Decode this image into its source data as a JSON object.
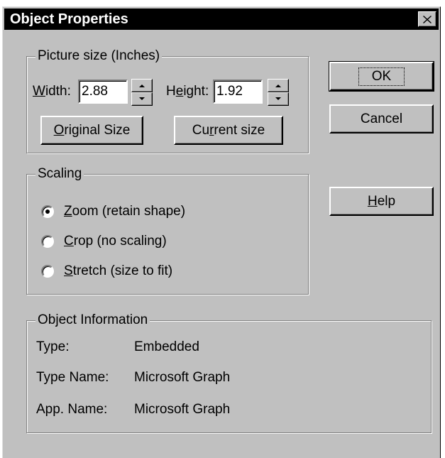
{
  "title": "Object Properties",
  "picture_size": {
    "group_label": "Picture size (Inches)",
    "width_label_u": "W",
    "width_label_rest": "idth:",
    "width_value": "2.88",
    "height_label_pre": "H",
    "height_label_u": "e",
    "height_label_rest": "ight:",
    "height_value": "1.92",
    "original_u": "O",
    "original_rest": "riginal Size",
    "current_pre": "Cu",
    "current_u": "r",
    "current_rest": "rent size"
  },
  "scaling": {
    "group_label": "Scaling",
    "options": [
      {
        "u": "Z",
        "rest": "oom (retain shape)",
        "selected": true
      },
      {
        "u": "C",
        "rest": "rop (no scaling)",
        "selected": false
      },
      {
        "u": "S",
        "rest": "tretch (size to fit)",
        "selected": false
      }
    ]
  },
  "object_info": {
    "group_label": "Object Information",
    "rows": [
      {
        "label": "Type:",
        "value": "Embedded"
      },
      {
        "label": "Type Name:",
        "value": "Microsoft Graph"
      },
      {
        "label": "App. Name:",
        "value": "Microsoft Graph"
      }
    ]
  },
  "buttons": {
    "ok": "OK",
    "cancel": "Cancel",
    "help_u": "H",
    "help_rest": "elp"
  },
  "icons": {
    "close": "close-icon",
    "spin_up": "up-arrow-icon",
    "spin_down": "down-arrow-icon"
  },
  "colors": {
    "face": "#c0c0c0",
    "titlebar": "#000000",
    "title_text": "#ffffff"
  }
}
